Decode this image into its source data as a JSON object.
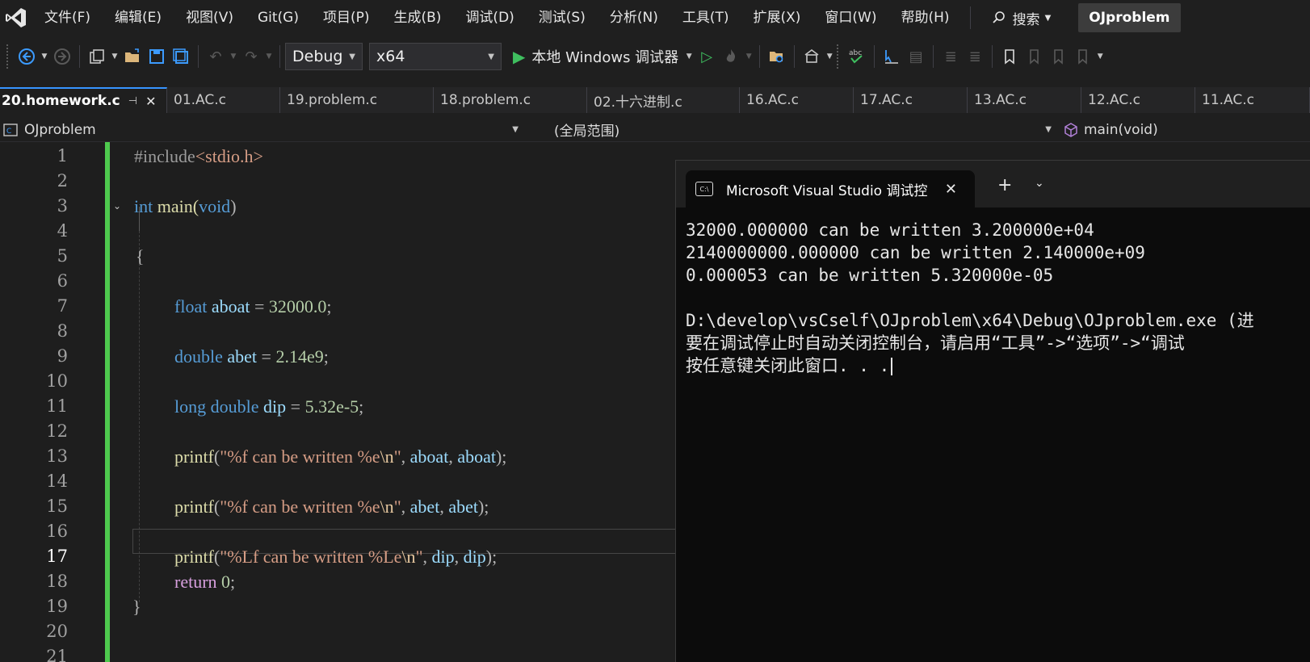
{
  "menu": {
    "items": [
      "文件(F)",
      "编辑(E)",
      "视图(V)",
      "Git(G)",
      "项目(P)",
      "生成(B)",
      "调试(D)",
      "测试(S)",
      "分析(N)",
      "工具(T)",
      "扩展(X)",
      "窗口(W)",
      "帮助(H)"
    ],
    "search_label": "搜索",
    "solution_name": "OJproblem"
  },
  "toolbar": {
    "configuration": "Debug",
    "platform": "x64",
    "run_label": "本地 Windows 调试器"
  },
  "tabs": [
    {
      "label": "20.homework.c",
      "active": true
    },
    {
      "label": "01.AC.c"
    },
    {
      "label": "19.problem.c"
    },
    {
      "label": "18.problem.c"
    },
    {
      "label": "02.十六进制.c"
    },
    {
      "label": "16.AC.c"
    },
    {
      "label": "17.AC.c"
    },
    {
      "label": "13.AC.c"
    },
    {
      "label": "12.AC.c"
    },
    {
      "label": "11.AC.c"
    }
  ],
  "navbar": {
    "project": "OJproblem",
    "scope": "(全局范围)",
    "member": "main(void)"
  },
  "editor": {
    "line_numbers": [
      "1",
      "2",
      "3",
      "4",
      "5",
      "6",
      "7",
      "8",
      "9",
      "10",
      "11",
      "12",
      "13",
      "14",
      "15",
      "16",
      "17",
      "18",
      "19",
      "20",
      "21"
    ],
    "current_line": 17,
    "code": {
      "l1": {
        "a": "#include",
        "b": "<stdio.h>"
      },
      "l3": {
        "a": "int",
        "b": " main(",
        "c": "void",
        "d": ")"
      },
      "l5": {
        "a": "{"
      },
      "l7": {
        "a": "float",
        "b": " aboat",
        "c": " = ",
        "d": "32000.0",
        "e": ";"
      },
      "l9": {
        "a": "double",
        "b": " abet",
        "c": " = ",
        "d": "2.14e9",
        "e": ";"
      },
      "l11": {
        "a": "long",
        "b": " double",
        "c": " dip",
        "d": " = ",
        "e": "5.32e-5",
        "f": ";"
      },
      "l13": {
        "a": "printf",
        "b": "(",
        "c": "\"%f can be written %e",
        "d": "\\n",
        "e": "\"",
        "f": ", ",
        "g": "aboat",
        "h": ", ",
        "i": "aboat",
        "j": ");"
      },
      "l15": {
        "a": "printf",
        "b": "(",
        "c": "\"%f can be written %e",
        "d": "\\n",
        "e": "\"",
        "f": ", ",
        "g": "abet",
        "h": ", ",
        "i": "abet",
        "j": ");"
      },
      "l17": {
        "a": "printf",
        "b": "(",
        "c": "\"%Lf can be written %Le",
        "d": "\\n",
        "e": "\"",
        "f": ", ",
        "g": "dip",
        "h": ", ",
        "i": "dip",
        "j": ");"
      },
      "l18": {
        "a": "return",
        "b": " ",
        "c": "0",
        "d": ";"
      },
      "l19": {
        "a": "}"
      }
    }
  },
  "console": {
    "title": "Microsoft Visual Studio 调试控",
    "lines": [
      "32000.000000 can be written 3.200000e+04",
      "2140000000.000000 can be written 2.140000e+09",
      "0.000053 can be written 5.320000e-05",
      "",
      "D:\\develop\\vsCself\\OJproblem\\x64\\Debug\\OJproblem.exe (进",
      "要在调试停止时自动关闭控制台，请启用“工具”->“选项”->“调试",
      "按任意键关闭此窗口. . ."
    ]
  },
  "colors": {
    "accent": "#3794ff",
    "change_bar": "#4ec94e",
    "keyword": "#569cd6",
    "string": "#d69d85",
    "function": "#dcdcaa",
    "variable": "#9cdcfe",
    "number": "#b5cea8"
  }
}
